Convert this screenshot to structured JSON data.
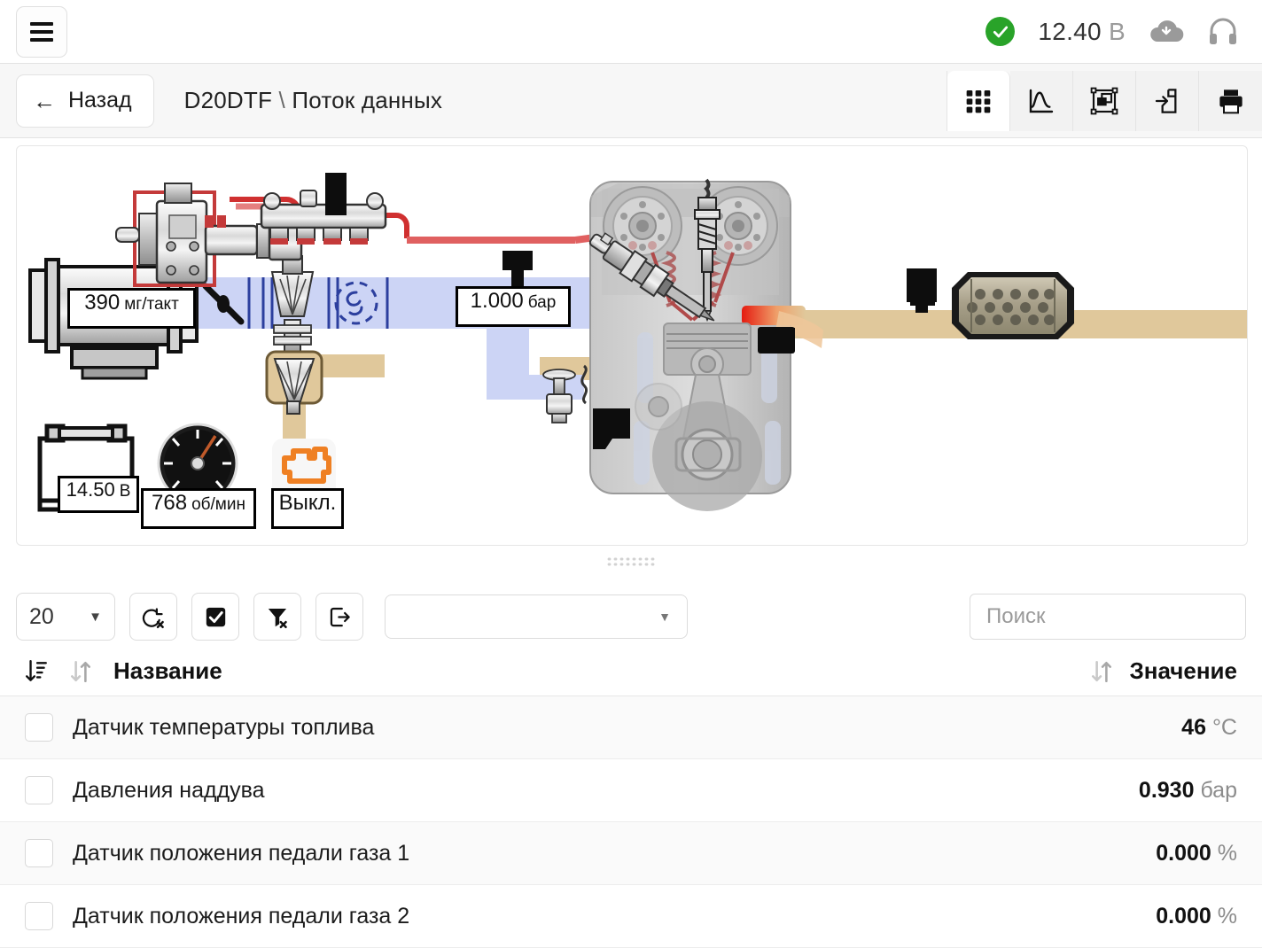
{
  "topbar": {
    "menu_icon": "hamburger-menu-icon",
    "connection_status_icon": "green-check-circle-icon",
    "voltage_value": "12.40",
    "voltage_unit": "В",
    "cloud_icon": "cloud-download-icon",
    "headset_icon": "headset-support-icon"
  },
  "navbar": {
    "back_label": "Назад",
    "back_arrow": "←",
    "breadcrumb_vehicle": "D20DTF",
    "breadcrumb_separator": "\\",
    "breadcrumb_page": "Поток данных",
    "tools": [
      {
        "name": "grid-view-button",
        "icon": "grid-icon",
        "active": true
      },
      {
        "name": "graph-view-button",
        "icon": "line-chart-icon",
        "active": false
      },
      {
        "name": "diagram-view-button",
        "icon": "frame-select-icon",
        "active": false
      },
      {
        "name": "import-button",
        "icon": "document-import-icon",
        "active": false
      },
      {
        "name": "print-button",
        "icon": "printer-icon",
        "active": false
      }
    ]
  },
  "diagram": {
    "air_mass_value": "390",
    "air_mass_unit": "мг/такт",
    "boost_value": "1.000",
    "boost_unit": "бар",
    "battery_value": "14.50",
    "battery_unit": "В",
    "rpm_value": "768",
    "rpm_unit": "об/мин",
    "mil_value": "Выкл.",
    "mil_icon": "check-engine-icon",
    "battery_icon": "battery-icon",
    "tachometer_icon": "tachometer-icon",
    "components": {
      "fuel_pump": "high-pressure-fuel-pump",
      "fuel_rail": "common-rail",
      "maf_sensor": "mass-air-flow-sensor",
      "throttle": "throttle-valve",
      "turbo": "turbocharger",
      "compressor": "compressor-icon",
      "egr_valve": "egr-valve",
      "engine": "engine-cross-section",
      "injector": "fuel-injector",
      "glow_plug": "glow-plug",
      "catalytic_converter": "catalytic-converter",
      "exhaust_sensor": "exhaust-temperature-sensor",
      "intake_sensor": "intake-pressure-sensor",
      "knock_sensor": "knock-sensor"
    },
    "colors": {
      "intake_air": "#ccd4f5",
      "exhaust": "#e0c89b",
      "fuel_line": "#e06060",
      "hot_gas": "#e02020",
      "mil_orange": "#ef8023"
    }
  },
  "controls": {
    "page_size_value": "20",
    "page_size_chevron": "▼",
    "buttons": [
      {
        "name": "clear-query-button",
        "icon": "clear-query-icon"
      },
      {
        "name": "select-all-button",
        "icon": "checkbox-checked-icon"
      },
      {
        "name": "clear-filter-button",
        "icon": "filter-clear-icon"
      },
      {
        "name": "export-button",
        "icon": "export-arrow-icon"
      }
    ],
    "filter_select_value": "",
    "filter_select_chevron": "▼",
    "search_placeholder": "Поиск"
  },
  "table": {
    "sort_icon": "sort-descending-icon",
    "col_name_sort_icon": "sort-toggle-icon",
    "col_name": "Название",
    "col_value_sort_icon": "sort-toggle-icon",
    "col_value": "Значение",
    "rows": [
      {
        "name": "Датчик температуры топлива",
        "value": "46",
        "unit": "°C"
      },
      {
        "name": "Давления наддува",
        "value": "0.930",
        "unit": "бар"
      },
      {
        "name": "Датчик положения педали газа 1",
        "value": "0.000",
        "unit": "%"
      },
      {
        "name": "Датчик положения педали газа 2",
        "value": "0.000",
        "unit": "%"
      }
    ]
  }
}
